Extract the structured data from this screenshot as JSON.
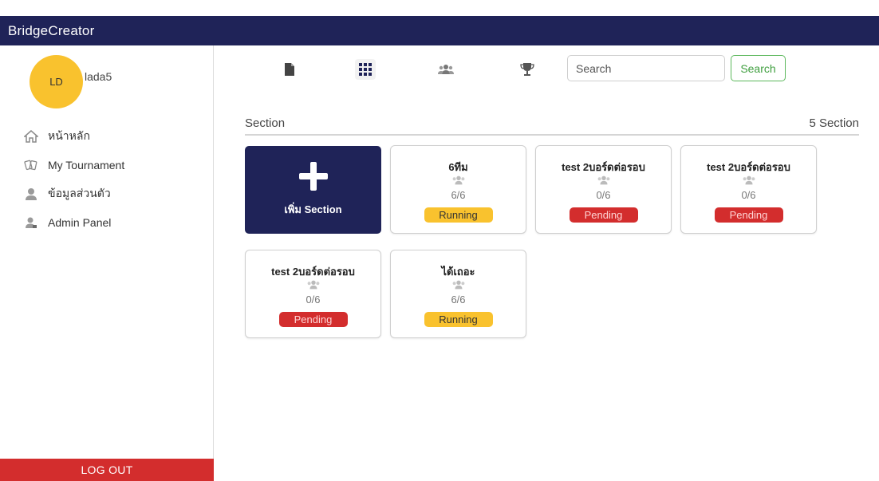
{
  "app": {
    "title": "BridgeCreator"
  },
  "user": {
    "initials": "LD",
    "name": "lada5",
    "avatar_color": "#f9c22e"
  },
  "sidebar": {
    "items": [
      {
        "label": "หน้าหลัก",
        "icon": "home-icon"
      },
      {
        "label": "My Tournament",
        "icon": "cards-icon"
      },
      {
        "label": "ข้อมูลส่วนตัว",
        "icon": "user-icon"
      },
      {
        "label": "Admin Panel",
        "icon": "admin-user-icon"
      }
    ],
    "logout_label": "LOG OUT"
  },
  "toolbar": {
    "icons": [
      "document-icon",
      "grid-icon",
      "users-icon",
      "trophy-icon"
    ],
    "search_placeholder": "Search",
    "search_button": "Search"
  },
  "section": {
    "label": "Section",
    "count": "5 Section",
    "add_label": "เพิ่ม Section",
    "cards": [
      {
        "name": "6ทีม",
        "ratio": "6/6",
        "status": "Running",
        "status_type": "running"
      },
      {
        "name": "test 2บอร์ดต่อรอบ",
        "ratio": "0/6",
        "status": "Pending",
        "status_type": "pending"
      },
      {
        "name": "test 2บอร์ดต่อรอบ",
        "ratio": "0/6",
        "status": "Pending",
        "status_type": "pending"
      },
      {
        "name": "test 2บอร์ดต่อรอบ",
        "ratio": "0/6",
        "status": "Pending",
        "status_type": "pending"
      },
      {
        "name": "ได้เถอะ",
        "ratio": "6/6",
        "status": "Running",
        "status_type": "running"
      }
    ]
  },
  "colors": {
    "navbar": "#1f2358",
    "running": "#f9c22e",
    "pending": "#d32d2d",
    "search_button": "#5cb85c",
    "logout": "#d32d2d"
  }
}
